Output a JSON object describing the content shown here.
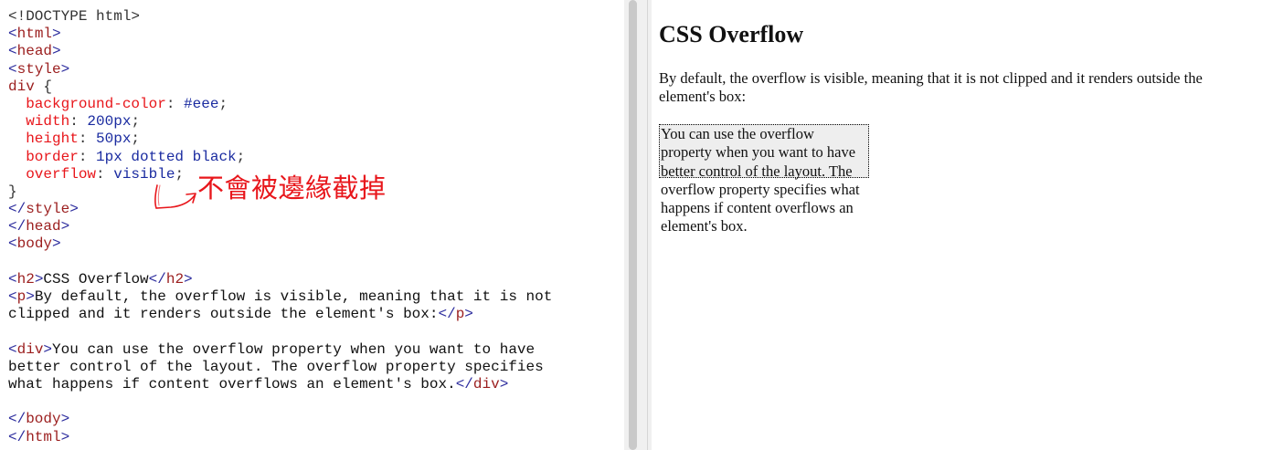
{
  "editor": {
    "lines": [
      {
        "highlight": "none",
        "tokens": [
          {
            "c": "plain",
            "t": "<!DOCTYPE html>"
          }
        ]
      },
      {
        "highlight": "none",
        "tokens": [
          {
            "c": "bracket",
            "t": "<"
          },
          {
            "c": "tag",
            "t": "html"
          },
          {
            "c": "bracket",
            "t": ">"
          }
        ]
      },
      {
        "highlight": "none",
        "tokens": [
          {
            "c": "bracket",
            "t": "<"
          },
          {
            "c": "tag",
            "t": "head"
          },
          {
            "c": "bracket",
            "t": ">"
          }
        ]
      },
      {
        "highlight": "none",
        "tokens": [
          {
            "c": "bracket",
            "t": "<"
          },
          {
            "c": "tag",
            "t": "style"
          },
          {
            "c": "bracket",
            "t": ">"
          }
        ]
      },
      {
        "highlight": "none",
        "tokens": [
          {
            "c": "tag",
            "t": "div"
          },
          {
            "c": "punct",
            "t": " {"
          }
        ]
      },
      {
        "highlight": "none",
        "tokens": [
          {
            "c": "plain",
            "t": "  "
          },
          {
            "c": "prop",
            "t": "background-color"
          },
          {
            "c": "punct",
            "t": ": "
          },
          {
            "c": "value",
            "t": "#eee"
          },
          {
            "c": "punct",
            "t": ";"
          }
        ]
      },
      {
        "highlight": "full",
        "tokens": [
          {
            "c": "plain",
            "t": "  "
          },
          {
            "c": "prop",
            "t": "width"
          },
          {
            "c": "punct",
            "t": ": "
          },
          {
            "c": "value",
            "t": "200px"
          },
          {
            "c": "punct",
            "t": ";"
          }
        ]
      },
      {
        "highlight": "partial",
        "tokens": [
          {
            "c": "plain",
            "t": "  "
          },
          {
            "c": "prop",
            "t": "height"
          },
          {
            "c": "punct",
            "t": ": "
          },
          {
            "c": "value",
            "t": "50px"
          },
          {
            "c": "punct",
            "t": ";"
          }
        ]
      },
      {
        "highlight": "none",
        "tokens": [
          {
            "c": "plain",
            "t": "  "
          },
          {
            "c": "prop",
            "t": "border"
          },
          {
            "c": "punct",
            "t": ": "
          },
          {
            "c": "value",
            "t": "1px dotted black"
          },
          {
            "c": "punct",
            "t": ";"
          }
        ]
      },
      {
        "highlight": "none",
        "tokens": [
          {
            "c": "plain",
            "t": "  "
          },
          {
            "c": "prop",
            "t": "overflow"
          },
          {
            "c": "punct",
            "t": ": "
          },
          {
            "c": "value",
            "t": "visible"
          },
          {
            "c": "punct",
            "t": ";"
          }
        ]
      },
      {
        "highlight": "none",
        "tokens": [
          {
            "c": "punct",
            "t": "}"
          }
        ]
      },
      {
        "highlight": "none",
        "tokens": [
          {
            "c": "bracket",
            "t": "</"
          },
          {
            "c": "tag",
            "t": "style"
          },
          {
            "c": "bracket",
            "t": ">"
          }
        ]
      },
      {
        "highlight": "none",
        "tokens": [
          {
            "c": "bracket",
            "t": "</"
          },
          {
            "c": "tag",
            "t": "head"
          },
          {
            "c": "bracket",
            "t": ">"
          }
        ]
      },
      {
        "highlight": "none",
        "tokens": [
          {
            "c": "bracket",
            "t": "<"
          },
          {
            "c": "tag",
            "t": "body"
          },
          {
            "c": "bracket",
            "t": ">"
          }
        ]
      },
      {
        "highlight": "none",
        "tokens": [
          {
            "c": "plain",
            "t": " "
          }
        ]
      },
      {
        "highlight": "none",
        "tokens": [
          {
            "c": "bracket",
            "t": "<"
          },
          {
            "c": "tag",
            "t": "h2"
          },
          {
            "c": "bracket",
            "t": ">"
          },
          {
            "c": "text",
            "t": "CSS Overflow"
          },
          {
            "c": "bracket",
            "t": "</"
          },
          {
            "c": "tag",
            "t": "h2"
          },
          {
            "c": "bracket",
            "t": ">"
          }
        ]
      },
      {
        "highlight": "none",
        "tokens": [
          {
            "c": "bracket",
            "t": "<"
          },
          {
            "c": "tag",
            "t": "p"
          },
          {
            "c": "bracket",
            "t": ">"
          },
          {
            "c": "text",
            "t": "By default, the overflow is visible, meaning that it is not"
          }
        ]
      },
      {
        "highlight": "none",
        "tokens": [
          {
            "c": "text",
            "t": "clipped and it renders outside the element's box:"
          },
          {
            "c": "bracket",
            "t": "</"
          },
          {
            "c": "tag",
            "t": "p"
          },
          {
            "c": "bracket",
            "t": ">"
          }
        ]
      },
      {
        "highlight": "none",
        "tokens": [
          {
            "c": "plain",
            "t": " "
          }
        ]
      },
      {
        "highlight": "none",
        "tokens": [
          {
            "c": "bracket",
            "t": "<"
          },
          {
            "c": "tag",
            "t": "div"
          },
          {
            "c": "bracket",
            "t": ">"
          },
          {
            "c": "text",
            "t": "You can use the overflow property when you want to have"
          }
        ]
      },
      {
        "highlight": "none",
        "tokens": [
          {
            "c": "text",
            "t": "better control of the layout. The overflow property specifies"
          }
        ]
      },
      {
        "highlight": "none",
        "tokens": [
          {
            "c": "text",
            "t": "what happens if content overflows an element's box."
          },
          {
            "c": "bracket",
            "t": "</"
          },
          {
            "c": "tag",
            "t": "div"
          },
          {
            "c": "bracket",
            "t": ">"
          }
        ]
      },
      {
        "highlight": "none",
        "tokens": [
          {
            "c": "plain",
            "t": " "
          }
        ]
      },
      {
        "highlight": "none",
        "tokens": [
          {
            "c": "bracket",
            "t": "</"
          },
          {
            "c": "tag",
            "t": "body"
          },
          {
            "c": "bracket",
            "t": ">"
          }
        ]
      },
      {
        "highlight": "none",
        "tokens": [
          {
            "c": "bracket",
            "t": "</"
          },
          {
            "c": "tag",
            "t": "html"
          },
          {
            "c": "bracket",
            "t": ">"
          }
        ]
      }
    ],
    "annotation": "不會被邊緣截掉",
    "colors": {
      "tag": "#9b1e1e",
      "bracket": "#2d2d9e",
      "property": "#e8161b",
      "value": "#1a2ba0",
      "selection": "#cfd1f0",
      "annotation": "#e8161b"
    }
  },
  "preview": {
    "heading": "CSS Overflow",
    "paragraph": "By default, the overflow is visible, meaning that it is not clipped and it renders outside the element's box:",
    "box_text": "You can use the overflow property when you want to have better control of the layout. The overflow property specifies what happens if content overflows an element's box.",
    "box_background": "#eeeeee"
  }
}
